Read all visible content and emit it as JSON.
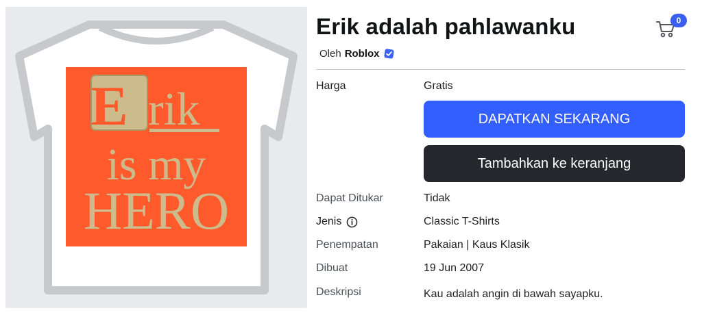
{
  "item": {
    "title": "Erik adalah pahlawanku",
    "by_prefix": "Oleh",
    "creator": "Roblox",
    "verified_icon": "verified-badge-icon",
    "thumbnail": {
      "line1": "Erik",
      "line2": "is my",
      "line3": "HERO",
      "shirt_color": "#ffffff",
      "print_color": "#ff5a2b",
      "text_color": "#cdbb8b"
    }
  },
  "cart": {
    "icon": "shopping-cart-icon",
    "count": "0",
    "badge_color": "#3b5ff0"
  },
  "price": {
    "label": "Harga",
    "value": "Gratis"
  },
  "buttons": {
    "get_now": "DAPATKAN SEKARANG",
    "add_to_cart": "Tambahkan ke keranjang",
    "primary_color": "#335fff",
    "secondary_color": "#25272c"
  },
  "details": {
    "tradable": {
      "label": "Dapat Ditukar",
      "value": "Tidak"
    },
    "type": {
      "label": "Jenis",
      "value": "Classic T-Shirts",
      "icon": "info-icon"
    },
    "placement": {
      "label": "Penempatan",
      "value": "Pakaian | Kaus Klasik"
    },
    "created": {
      "label": "Dibuat",
      "value": "19 Jun 2007"
    },
    "description": {
      "label": "Deskripsi",
      "value": "Kau adalah angin di bawah sayapku."
    }
  }
}
